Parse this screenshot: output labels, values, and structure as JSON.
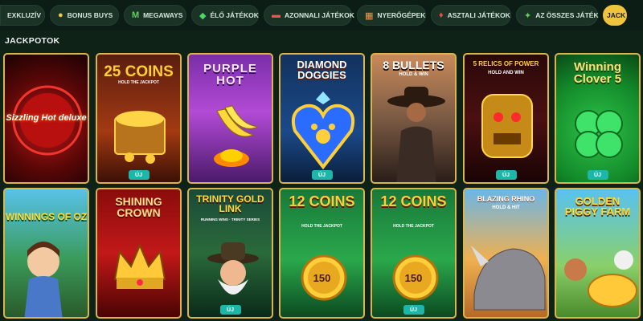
{
  "nav": {
    "items": [
      {
        "label": "EXKLUZÍV",
        "icon": "star-icon"
      },
      {
        "label": "BONUS BUYS",
        "icon": "coin-icon"
      },
      {
        "label": "MEGAWAYS",
        "icon": "megaways-m-icon"
      },
      {
        "label": "ÉLŐ JÁTÉKOK",
        "icon": "live-chip-icon"
      },
      {
        "label": "AZONNALI JÁTÉKOK",
        "icon": "instant-ticket-icon"
      },
      {
        "label": "NYERŐGÉPEK",
        "icon": "slot-machine-icon"
      },
      {
        "label": "ASZTALI JÁTÉKOK",
        "icon": "cards-icon"
      },
      {
        "label": "AZ ÖSSZES JÁTÉK",
        "icon": "all-games-icon"
      },
      {
        "label": "JACK",
        "icon": ""
      }
    ]
  },
  "section": {
    "title": "JACKPOTOK"
  },
  "games": [
    {
      "title": "Sizzling Hot deluxe",
      "badge": ""
    },
    {
      "title": "25 COINS",
      "subtitle": "HOLD THE JACKPOT",
      "badge": "ÚJ"
    },
    {
      "title": "PURPLE HOT",
      "badge": ""
    },
    {
      "title": "DIAMOND DOGGIES",
      "badge": "ÚJ"
    },
    {
      "title": "8 BULLETS",
      "subtitle": "HOLD & WIN",
      "badge": ""
    },
    {
      "title": "5 RELICS OF POWER",
      "subtitle": "HOLD AND WIN",
      "badge": "ÚJ"
    },
    {
      "title": "Winning Clover 5",
      "badge": "ÚJ"
    },
    {
      "title": "WINNINGS OF OZ",
      "badge": ""
    },
    {
      "title": "SHINING CROWN",
      "badge": ""
    },
    {
      "title": "TRINITY GOLD LINK",
      "subtitle": "RUNNING WINS · TRINITY SERIES",
      "badge": "ÚJ"
    },
    {
      "title": "12 COINS",
      "subtitle": "HOLD THE JACKPOT",
      "amount": "150",
      "badge": ""
    },
    {
      "title": "12 COINS",
      "subtitle": "HOLD THE JACKPOT",
      "amount": "150",
      "badge": "ÚJ"
    },
    {
      "title": "BLAZING RHINO",
      "subtitle": "HOLD & HIT",
      "badge": ""
    },
    {
      "title": "GOLDEN PIGGY FARM",
      "badge": ""
    }
  ],
  "colors": {
    "accent": "#f0c33c",
    "badge": "#1db6a8",
    "background": "#0e2218"
  }
}
